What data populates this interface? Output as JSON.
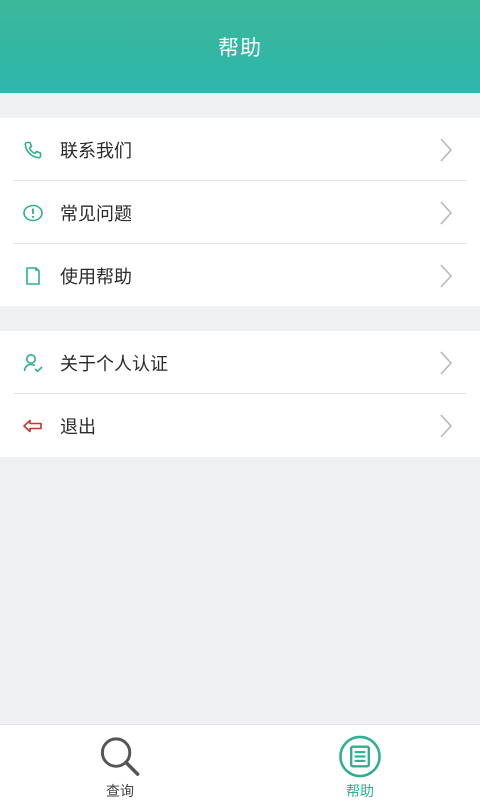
{
  "header": {
    "title": "帮助"
  },
  "group1": {
    "items": [
      {
        "label": "联系我们",
        "icon": "phone-icon"
      },
      {
        "label": "常见问题",
        "icon": "exclamation-circle-icon"
      },
      {
        "label": "使用帮助",
        "icon": "document-icon"
      }
    ]
  },
  "group2": {
    "items": [
      {
        "label": "关于个人认证",
        "icon": "user-verified-icon"
      },
      {
        "label": "退出",
        "icon": "exit-arrow-icon"
      }
    ]
  },
  "tabbar": {
    "tabs": [
      {
        "label": "查询",
        "icon": "search-icon",
        "active": false
      },
      {
        "label": "帮助",
        "icon": "list-document-icon",
        "active": true
      }
    ]
  },
  "colors": {
    "header_top": "#3ab898",
    "header_bottom": "#2eb5ad",
    "accent": "#2db08f",
    "exit_icon": "#c0392b",
    "background": "#eff0f2"
  }
}
